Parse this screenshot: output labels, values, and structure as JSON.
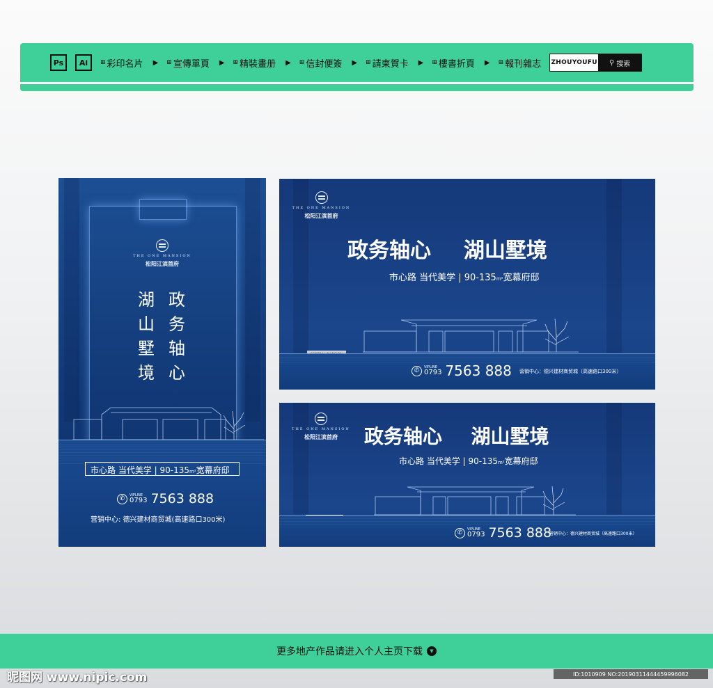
{
  "nav": {
    "ps_badge": "Ps",
    "ai_badge": "Ai",
    "items": [
      {
        "label": "彩印名片"
      },
      {
        "label": "宣傳單頁"
      },
      {
        "label": "精裝畫册"
      },
      {
        "label": "信封便簽"
      },
      {
        "label": "請柬賀卡"
      },
      {
        "label": "樓書折頁"
      },
      {
        "label": "報刊雜志"
      }
    ],
    "grid_glyph": "⊞",
    "arrow_glyph": "▶",
    "search_value": "ZHOUYOUFU",
    "search_button": "搜索",
    "search_icon_glyph": "⚲"
  },
  "brand": {
    "en": "THE ONE MANSION",
    "cn": "松阳江滨首府"
  },
  "headline": {
    "part1": "政务轴心",
    "part2": "湖山墅境",
    "col_right": [
      "政",
      "务",
      "轴",
      "心"
    ],
    "col_left": [
      "湖",
      "山",
      "墅",
      "境"
    ]
  },
  "subline": {
    "text": "市心路  当代美学 | 90-135",
    "unit": "m²",
    "tail": "宽幕府邸"
  },
  "plaque_text": "CENTRAL MANSION",
  "contact": {
    "phone_icon": "✆",
    "vip_label": "VIPLINE",
    "area_code": "0793",
    "number": "7563 888",
    "sales_vertical": "营销中心: 德兴建材商贸城(高速路口300米)",
    "sales_horizontal": "营销中心：德兴建材商贸城（高速路口300米）"
  },
  "footer": {
    "cta": "更多地产作品请进入个人主页下载",
    "cta_icon": "▼",
    "watermark": "昵图网 www.nipic.com",
    "id_tag": "ID:1010909 NO:20190311444459996082"
  },
  "colors": {
    "accent_green": "#3fcf98",
    "navy": "#163f82"
  }
}
